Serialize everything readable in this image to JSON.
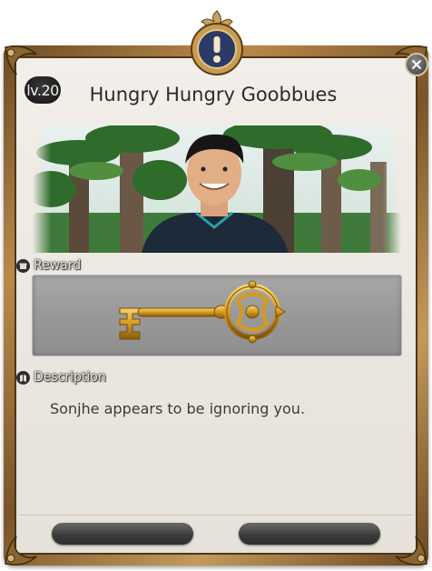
{
  "quest": {
    "level": "lv.20",
    "title": "Hungry Hungry Goobbues"
  },
  "reward": {
    "label": "Reward",
    "item_icon": "golden-key-icon"
  },
  "description": {
    "label": "Description",
    "text": "Sonjhe appears to be ignoring you."
  },
  "buttons": {
    "left_label": "",
    "right_label": ""
  },
  "icons": {
    "emblem": "exclamation-emblem-icon",
    "close": "close-icon"
  },
  "colors": {
    "frame_gold": "#b98a4a",
    "panel_bg": "#ebe7e0",
    "reward_bg": "#999999",
    "emblem_blue": "#2b3a66"
  }
}
